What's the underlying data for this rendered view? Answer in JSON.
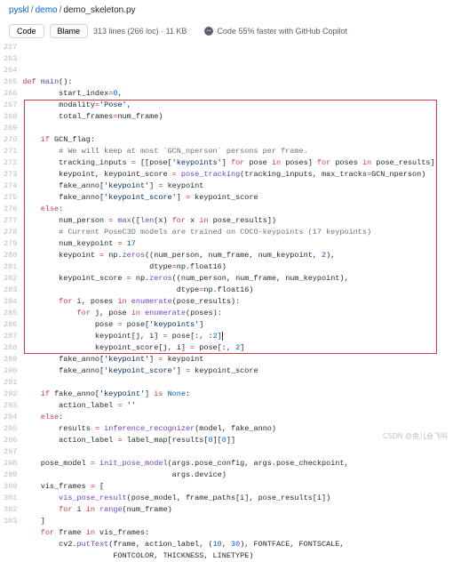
{
  "breadcrumb": {
    "a": "pyskl",
    "b": "demo",
    "c": "demo_skeleton.py"
  },
  "toolbar": {
    "code": "Code",
    "blame": "Blame",
    "meta": "313 lines (266 loc) · 11 KB",
    "copilot": "Code 55% faster with GitHub Copilot"
  },
  "gutter_start": 227,
  "gutter_skip": {
    "after": 227,
    "to": 263
  },
  "gutter_end": 303,
  "highlight": {
    "from": 267,
    "to": 288
  },
  "lines": {
    "227": [
      [
        "k",
        "def "
      ],
      [
        "f",
        "main"
      ],
      [
        "p",
        "():"
      ]
    ],
    "263": [
      [
        "p",
        "        start_index"
      ],
      [
        "k",
        "="
      ],
      [
        "n",
        "0"
      ],
      [
        "p",
        ","
      ]
    ],
    "264": [
      [
        "p",
        "        modality"
      ],
      [
        "k",
        "="
      ],
      [
        "s",
        "'Pose'"
      ],
      [
        "p",
        ","
      ]
    ],
    "265": [
      [
        "p",
        "        total_frames"
      ],
      [
        "k",
        "="
      ],
      [
        "p",
        "num_frame)"
      ]
    ],
    "266": [
      [
        "p",
        ""
      ]
    ],
    "267": [
      [
        "p",
        "    "
      ],
      [
        "k",
        "if"
      ],
      [
        "p",
        " GCN_flag:"
      ]
    ],
    "268": [
      [
        "p",
        "        "
      ],
      [
        "c",
        "# We will keep at most `GCN_nperson` persons per frame."
      ]
    ],
    "269": [
      [
        "p",
        "        tracking_inputs "
      ],
      [
        "k",
        "="
      ],
      [
        "p",
        " [[pose["
      ],
      [
        "s",
        "'keypoints'"
      ],
      [
        "p",
        "] "
      ],
      [
        "k",
        "for"
      ],
      [
        "p",
        " pose "
      ],
      [
        "k",
        "in"
      ],
      [
        "p",
        " poses] "
      ],
      [
        "k",
        "for"
      ],
      [
        "p",
        " poses "
      ],
      [
        "k",
        "in"
      ],
      [
        "p",
        " pose_results]"
      ]
    ],
    "270": [
      [
        "p",
        "        keypoint, keypoint_score "
      ],
      [
        "k",
        "="
      ],
      [
        "p",
        " "
      ],
      [
        "f",
        "pose_tracking"
      ],
      [
        "p",
        "(tracking_inputs, max_tracks"
      ],
      [
        "k",
        "="
      ],
      [
        "p",
        "GCN_nperson)"
      ]
    ],
    "271": [
      [
        "p",
        "        fake_anno["
      ],
      [
        "s",
        "'keypoint'"
      ],
      [
        "p",
        "] "
      ],
      [
        "k",
        "="
      ],
      [
        "p",
        " keypoint"
      ]
    ],
    "272": [
      [
        "p",
        "        fake_anno["
      ],
      [
        "s",
        "'keypoint_score'"
      ],
      [
        "p",
        "] "
      ],
      [
        "k",
        "="
      ],
      [
        "p",
        " keypoint_score"
      ]
    ],
    "273": [
      [
        "p",
        "    "
      ],
      [
        "k",
        "else"
      ],
      [
        "p",
        ":"
      ]
    ],
    "274": [
      [
        "p",
        "        num_person "
      ],
      [
        "k",
        "="
      ],
      [
        "p",
        " "
      ],
      [
        "f",
        "max"
      ],
      [
        "p",
        "(["
      ],
      [
        "f",
        "len"
      ],
      [
        "p",
        "(x) "
      ],
      [
        "k",
        "for"
      ],
      [
        "p",
        " x "
      ],
      [
        "k",
        "in"
      ],
      [
        "p",
        " pose_results])"
      ]
    ],
    "275": [
      [
        "p",
        "        "
      ],
      [
        "c",
        "# Current PoseC3D models are trained on COCO-keypoints (17 keypoints)"
      ]
    ],
    "276": [
      [
        "p",
        "        num_keypoint "
      ],
      [
        "k",
        "="
      ],
      [
        "p",
        " "
      ],
      [
        "n",
        "17"
      ]
    ],
    "277": [
      [
        "p",
        "        keypoint "
      ],
      [
        "k",
        "="
      ],
      [
        "p",
        " np."
      ],
      [
        "f",
        "zeros"
      ],
      [
        "p",
        "((num_person, num_frame, num_keypoint, "
      ],
      [
        "n",
        "2"
      ],
      [
        "p",
        "),"
      ]
    ],
    "278": [
      [
        "p",
        "                            dtype"
      ],
      [
        "k",
        "="
      ],
      [
        "p",
        "np.float16)"
      ]
    ],
    "279": [
      [
        "p",
        "        keypoint_score "
      ],
      [
        "k",
        "="
      ],
      [
        "p",
        " np."
      ],
      [
        "f",
        "zeros"
      ],
      [
        "p",
        "((num_person, num_frame, num_keypoint),"
      ]
    ],
    "280": [
      [
        "p",
        "                                  dtype"
      ],
      [
        "k",
        "="
      ],
      [
        "p",
        "np.float16)"
      ]
    ],
    "281": [
      [
        "p",
        "        "
      ],
      [
        "k",
        "for"
      ],
      [
        "p",
        " i, poses "
      ],
      [
        "k",
        "in"
      ],
      [
        "p",
        " "
      ],
      [
        "f",
        "enumerate"
      ],
      [
        "p",
        "(pose_results):"
      ]
    ],
    "282": [
      [
        "p",
        "            "
      ],
      [
        "k",
        "for"
      ],
      [
        "p",
        " j, pose "
      ],
      [
        "k",
        "in"
      ],
      [
        "p",
        " "
      ],
      [
        "f",
        "enumerate"
      ],
      [
        "p",
        "(poses):"
      ]
    ],
    "283": [
      [
        "p",
        "                pose "
      ],
      [
        "k",
        "="
      ],
      [
        "p",
        " pose["
      ],
      [
        "s",
        "'keypoints'"
      ],
      [
        "p",
        "]"
      ]
    ],
    "284": [
      [
        "p",
        "                keypoint[j, i] "
      ],
      [
        "k",
        "="
      ],
      [
        "p",
        " pose[:, :"
      ],
      [
        "n",
        "2"
      ],
      [
        "p",
        "]"
      ],
      [
        "cur",
        ""
      ]
    ],
    "285": [
      [
        "p",
        "                keypoint_score[j, i] "
      ],
      [
        "k",
        "="
      ],
      [
        "p",
        " pose[:, "
      ],
      [
        "n",
        "2"
      ],
      [
        "p",
        "]"
      ]
    ],
    "286": [
      [
        "p",
        "        fake_anno["
      ],
      [
        "s",
        "'keypoint'"
      ],
      [
        "p",
        "] "
      ],
      [
        "k",
        "="
      ],
      [
        "p",
        " keypoint"
      ]
    ],
    "287": [
      [
        "p",
        "        fake_anno["
      ],
      [
        "s",
        "'keypoint_score'"
      ],
      [
        "p",
        "] "
      ],
      [
        "k",
        "="
      ],
      [
        "p",
        " keypoint_score"
      ]
    ],
    "288": [
      [
        "p",
        ""
      ]
    ],
    "289": [
      [
        "p",
        "    "
      ],
      [
        "k",
        "if"
      ],
      [
        "p",
        " fake_anno["
      ],
      [
        "s",
        "'keypoint'"
      ],
      [
        "p",
        "] "
      ],
      [
        "k",
        "is"
      ],
      [
        "p",
        " "
      ],
      [
        "n",
        "None"
      ],
      [
        "p",
        ":"
      ]
    ],
    "290": [
      [
        "p",
        "        action_label "
      ],
      [
        "k",
        "="
      ],
      [
        "p",
        " "
      ],
      [
        "s",
        "''"
      ]
    ],
    "291": [
      [
        "p",
        "    "
      ],
      [
        "k",
        "else"
      ],
      [
        "p",
        ":"
      ]
    ],
    "292": [
      [
        "p",
        "        results "
      ],
      [
        "k",
        "="
      ],
      [
        "p",
        " "
      ],
      [
        "f",
        "inference_recognizer"
      ],
      [
        "p",
        "(model, fake_anno)"
      ]
    ],
    "293": [
      [
        "p",
        "        action_label "
      ],
      [
        "k",
        "="
      ],
      [
        "p",
        " label_map[results["
      ],
      [
        "n",
        "0"
      ],
      [
        "p",
        "]["
      ],
      [
        "n",
        "0"
      ],
      [
        "p",
        "]]"
      ]
    ],
    "294": [
      [
        "p",
        ""
      ]
    ],
    "295": [
      [
        "p",
        "    pose_model "
      ],
      [
        "k",
        "="
      ],
      [
        "p",
        " "
      ],
      [
        "f",
        "init_pose_model"
      ],
      [
        "p",
        "(args.pose_config, args.pose_checkpoint,"
      ]
    ],
    "296": [
      [
        "p",
        "                                 args.device)"
      ]
    ],
    "297": [
      [
        "p",
        "    vis_frames "
      ],
      [
        "k",
        "="
      ],
      [
        "p",
        " ["
      ]
    ],
    "298": [
      [
        "p",
        "        "
      ],
      [
        "f",
        "vis_pose_result"
      ],
      [
        "p",
        "(pose_model, frame_paths[i], pose_results[i])"
      ]
    ],
    "299": [
      [
        "p",
        "        "
      ],
      [
        "k",
        "for"
      ],
      [
        "p",
        " i "
      ],
      [
        "k",
        "in"
      ],
      [
        "p",
        " "
      ],
      [
        "f",
        "range"
      ],
      [
        "p",
        "(num_frame)"
      ]
    ],
    "300": [
      [
        "p",
        "    ]"
      ]
    ],
    "301": [
      [
        "p",
        "    "
      ],
      [
        "k",
        "for"
      ],
      [
        "p",
        " frame "
      ],
      [
        "k",
        "in"
      ],
      [
        "p",
        " vis_frames:"
      ]
    ],
    "302": [
      [
        "p",
        "        cv2."
      ],
      [
        "f",
        "putText"
      ],
      [
        "p",
        "(frame, action_label, ("
      ],
      [
        "n",
        "10"
      ],
      [
        "p",
        ", "
      ],
      [
        "n",
        "30"
      ],
      [
        "p",
        "), FONTFACE, FONTSCALE,"
      ]
    ],
    "303": [
      [
        "p",
        "                    FONTCOLOR, THICKNESS, LINETYPE)"
      ]
    ]
  },
  "watermark": "CSDN @鱼儿会飞吗"
}
